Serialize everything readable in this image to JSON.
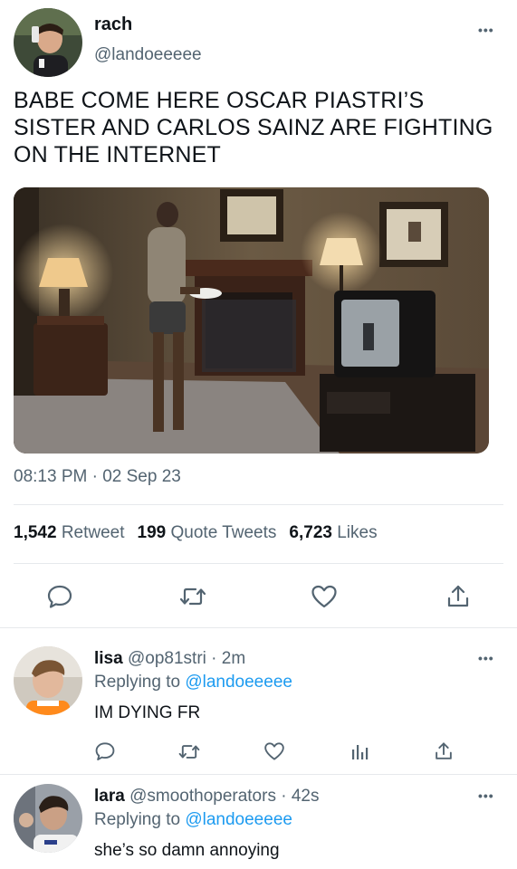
{
  "tweet": {
    "display_name": "rach",
    "handle": "@landoeeeee",
    "more_icon": "•••",
    "text": "BABE COME HERE OSCAR PIASTRI’S SISTER AND CARLOS SAINZ ARE FIGHTING ON THE INTERNET",
    "media_description": "still of a woman in a living room looking up, TV on the right",
    "time": "08:13 PM",
    "separator": "·",
    "date": "02 Sep 23",
    "stats": {
      "retweets_count": "1,542",
      "retweets_label": "Retweet",
      "quotes_count": "199",
      "quotes_label": "Quote Tweets",
      "likes_count": "6,723",
      "likes_label": "Likes"
    }
  },
  "replies": [
    {
      "display_name": "lisa",
      "handle": "@op81stri",
      "age": "2m",
      "replying_prefix": "Replying to",
      "replying_to": "@landoeeeee",
      "text": "IM DYING FR"
    },
    {
      "display_name": "lara",
      "handle": "@smoothoperators",
      "age": "42s",
      "replying_prefix": "Replying to",
      "replying_to": "@landoeeeee",
      "text": "she’s so damn annoying"
    }
  ],
  "colors": {
    "text": "#0f1419",
    "secondary": "#536471",
    "link": "#1d9bf0",
    "divider": "#e6e9ec"
  }
}
